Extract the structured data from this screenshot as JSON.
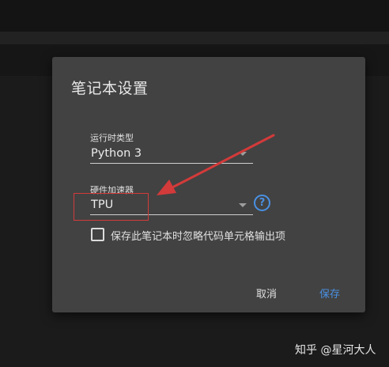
{
  "dialog": {
    "title": "笔记本设置",
    "runtime": {
      "label": "运行时类型",
      "value": "Python 3"
    },
    "accelerator": {
      "label": "硬件加速器",
      "value": "TPU"
    },
    "help_icon_glyph": "?",
    "omit_code_checkbox": {
      "checked": false,
      "label": "保存此笔记本时忽略代码单元格输出项"
    },
    "buttons": {
      "cancel": "取消",
      "save": "保存"
    }
  },
  "annotation": {
    "color": "#d33a3a"
  },
  "watermark": "知乎 @星河大人",
  "colors": {
    "dialog_bg": "#424242",
    "accent": "#4a90e2",
    "page_bg": "#1b1b1b"
  }
}
